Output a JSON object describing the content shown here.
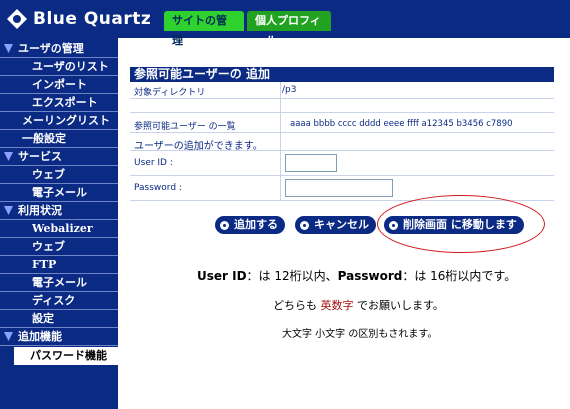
{
  "header": {
    "brand": "Blue Quartz",
    "tabs": [
      {
        "label": "サイトの管理",
        "active": true
      },
      {
        "label": "個人プロフィール",
        "active": false
      }
    ]
  },
  "sidebar": {
    "groups": [
      {
        "label": "ユーザの管理",
        "items": [
          "ユーザのリスト",
          "インポート",
          "エクスポート"
        ]
      },
      {
        "label": "メーリングリスト"
      },
      {
        "label": "一般設定"
      },
      {
        "label": "サービス",
        "items": [
          "ウェブ",
          "電子メール"
        ]
      },
      {
        "label": "利用状況",
        "items": [
          "Webalizer",
          "ウェブ",
          "FTP",
          "電子メール",
          "ディスク",
          "設定"
        ]
      },
      {
        "label": "追加機能",
        "items": [
          "パスワード機能"
        ]
      }
    ]
  },
  "main": {
    "section_title": "参照可能ユーザーの 追加",
    "rows": {
      "target_dir_label": "対象ディレクトリ",
      "target_dir_value": "/p3",
      "list_label": "参照可能ユーザー の一覧",
      "list_value": "aaaa bbbb cccc dddd eeee ffff a12345 b3456 c7890",
      "add_note": "ユーザーの追加ができます。",
      "userid_label": "User ID :",
      "userid_value": "",
      "password_label": "Password :",
      "password_value": ""
    },
    "buttons": {
      "add": "追加する",
      "cancel": "キャンセル",
      "delete_screen": "削除画面 に移動します"
    },
    "notes": {
      "line1_a": "User ID",
      "line1_b": "：は 12桁以内、",
      "line1_c": "Password",
      "line1_d": "：は 16桁以内です。",
      "line2_a": "どちらも ",
      "line2_b": "英数字",
      "line2_c": " でお願いします。",
      "line3": "大文字 小文字 の区別もされます。"
    }
  },
  "colors": {
    "navy": "#0a2a84",
    "tab_green": "#21a321",
    "tab_active": "#2ed12e",
    "highlight_red": "#d21a1a"
  }
}
